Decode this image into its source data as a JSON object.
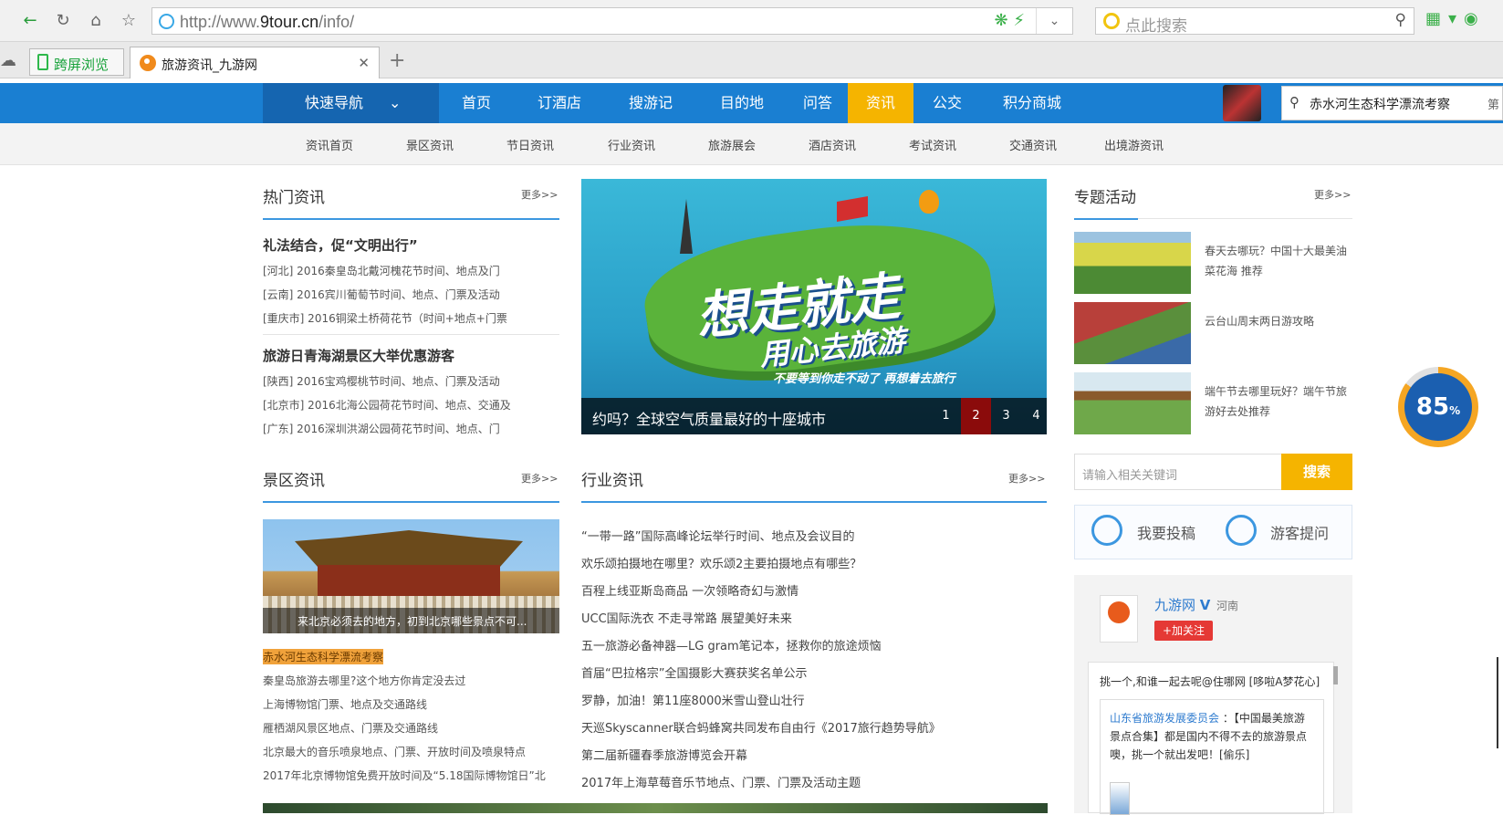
{
  "browser": {
    "url_prefix": "http://www.",
    "url_host": "9tour.cn",
    "url_path": "/info/",
    "search_placeholder": "点此搜索",
    "tabs": [
      {
        "label": "跨屏浏览"
      },
      {
        "label": "旅游资讯_九游网"
      }
    ]
  },
  "site_nav": {
    "quick_nav": "快速导航",
    "items": [
      "首页",
      "订酒店",
      "搜游记",
      "目的地",
      "问答",
      "资讯",
      "公交",
      "积分商城"
    ],
    "active": "资讯",
    "search_value": "赤水河生态科学漂流考察",
    "search_cut": "第"
  },
  "sub_nav": [
    "资讯首页",
    "景区资讯",
    "节日资讯",
    "行业资讯",
    "旅游展会",
    "酒店资讯",
    "考试资讯",
    "交通资讯",
    "出境游资讯"
  ],
  "hot_news": {
    "title": "热门资讯",
    "more": "更多>>",
    "groups": [
      {
        "headline": "礼法结合，促“文明出行”",
        "items": [
          "[河北] 2016秦皇岛北戴河槐花节时间、地点及门",
          "[云南] 2016宾川葡萄节时间、地点、门票及活动",
          "[重庆市] 2016铜梁土桥荷花节（时间+地点+门票"
        ]
      },
      {
        "headline": "旅游日青海湖景区大举优惠游客",
        "items": [
          "[陕西] 2016宝鸡樱桃节时间、地点、门票及活动",
          "[北京市] 2016北海公园荷花节时间、地点、交通及",
          "[广东] 2016深圳洪湖公园荷花节时间、地点、门"
        ]
      }
    ]
  },
  "banner": {
    "slogan": "想走就走",
    "slogan2": "用心去旅游",
    "tagline": "不要等到你走不动了 再想着去旅行",
    "caption": "约吗？全球空气质量最好的十座城市",
    "pages": [
      "1",
      "2",
      "3",
      "4"
    ],
    "active_page": 2
  },
  "topics": {
    "title": "专题活动",
    "more": "更多>>",
    "items": [
      {
        "text": "春天去哪玩？中国十大最美油菜花海 推荐"
      },
      {
        "text": "云台山周末两日游攻略"
      },
      {
        "text": "端午节去哪里玩好？端午节旅游好去处推荐"
      }
    ]
  },
  "sidebar_search": {
    "placeholder": "请输入相关关键词",
    "button": "搜索"
  },
  "actions": {
    "submit": "我要投稿",
    "ask": "游客提问"
  },
  "weibo": {
    "name": "九游网",
    "verified": "V",
    "place": "河南",
    "follow": "+加关注",
    "post": "挑一个,和谁一起去呢@住哪网 [哆啦A梦花心]",
    "card_user": "山东省旅游发展委员会",
    "card_text": "：【中国最美旅游景点合集】都是国内不得不去的旅游景点噢，挑一个就出发吧！[偷乐]"
  },
  "scenic": {
    "title": "景区资讯",
    "more": "更多>>",
    "photo_caption": "来北京必须去的地方，初到北京哪些景点不可...",
    "items": [
      "赤水河生态科学漂流考察",
      "秦皇岛旅游去哪里?这个地方你肯定没去过",
      "上海博物馆门票、地点及交通路线",
      "雁栖湖风景区地点、门票及交通路线",
      "北京最大的音乐喷泉地点、门票、开放时间及喷泉特点",
      "2017年北京博物馆免费开放时间及“5.18国际博物馆日”北"
    ]
  },
  "industry": {
    "title": "行业资讯",
    "more": "更多>>",
    "items": [
      "“一带一路”国际高峰论坛举行时间、地点及会议目的",
      "欢乐颂拍摄地在哪里？欢乐颂2主要拍摄地点有哪些？",
      "百程上线亚斯岛商品 一次领略奇幻与激情",
      "UCC国际洗衣 不走寻常路 展望美好未来",
      "五一旅游必备神器—LG gram笔记本，拯救你的旅途烦恼",
      "首届“巴拉格宗”全国摄影大赛获奖名单公示",
      "罗静，加油！第11座8000米雪山登山壮行",
      "天巡Skyscanner联合蚂蜂窝共同发布自由行《2017旅行趋势导航》",
      "第二届新疆春季旅游博览会开幕",
      "2017年上海草莓音乐节地点、门票、门票及活动主题"
    ]
  },
  "gauge": {
    "value": "85",
    "unit": "%",
    "fill": 0.85
  }
}
